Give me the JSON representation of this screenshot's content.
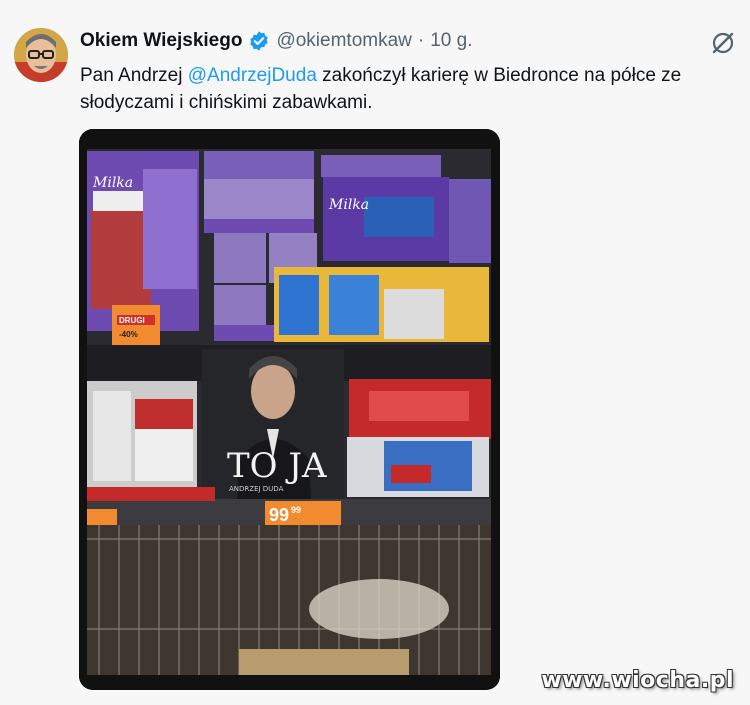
{
  "tweet": {
    "author_name": "Okiem Wiejskiego",
    "handle": "@okiemtomkaw",
    "separator": "·",
    "time": "10 g.",
    "text_before": "Pan Andrzej ",
    "mention": "@AndrzejDuda",
    "text_after": " zakończył karierę w Biedronce na półce ze słodyczami i chińskimi zabawkami."
  },
  "photo": {
    "book_title": "TO JA",
    "book_author": "ANDRZEJ DUDA",
    "price_tag_1": "99",
    "price_tag_1_cents": "99",
    "promo_sign": "DRUGI",
    "promo_discount": "-40%"
  },
  "watermark": "www.wiocha.pl",
  "colors": {
    "mention": "#1d9bf0",
    "verified": "#1d9bf0",
    "milka_purple": "#7b5db8",
    "price_orange": "#f28a30"
  }
}
